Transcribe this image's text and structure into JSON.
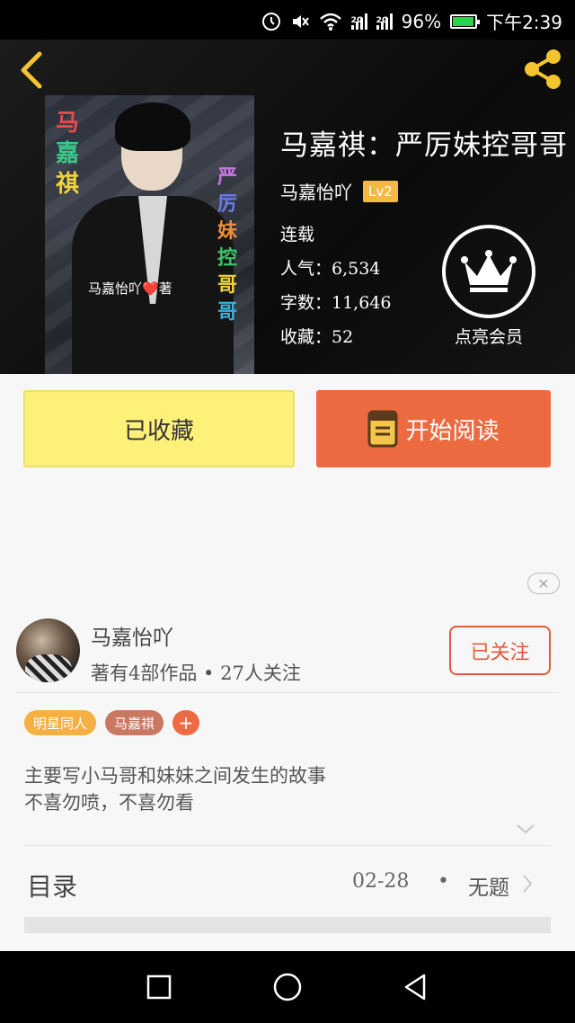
{
  "status_bar": {
    "signal_tag_1": "2G",
    "signal_tag_2": "2G",
    "battery": "96%",
    "battery_level": 0.96,
    "time": "下午2:39"
  },
  "book": {
    "title": "马嘉祺：严厉妹控哥哥",
    "author": "马嘉怡吖",
    "level": "Lv2",
    "status": "连载",
    "popularity": "人气：6,534",
    "word_count": "字数：11,646",
    "favorites": "收藏：52"
  },
  "cover": {
    "vertical_text_left": [
      "马",
      "嘉",
      "祺"
    ],
    "vertical_text_right": [
      "严",
      "厉",
      "妹",
      "控",
      "哥",
      "哥"
    ],
    "signature": "马嘉怡吖❤️著"
  },
  "vip": {
    "label": "点亮会员"
  },
  "actions": {
    "favorite_label": "已收藏",
    "read_label": "开始阅读"
  },
  "close_ad": "✕",
  "author_card": {
    "name": "马嘉怡吖",
    "meta": "著有4部作品 • 27人关注",
    "follow_label": "已关注"
  },
  "tags": [
    {
      "label": "明星同人"
    },
    {
      "label": "马嘉祺"
    }
  ],
  "tag_add": "+",
  "description": {
    "line1": "主要写小马哥和妹妹之间发生的故事",
    "line2": "不喜勿喷，不喜勿看"
  },
  "toc": {
    "label": "目录",
    "date": "02-28",
    "dot": "•",
    "chapter": "无题"
  },
  "colors": {
    "accent_orange": "#eb6a3f",
    "favorite_yellow": "#fdf17a",
    "tag_yellow": "#f4b043",
    "tag_brown": "#c97862",
    "level_badge": "#f4b942"
  }
}
